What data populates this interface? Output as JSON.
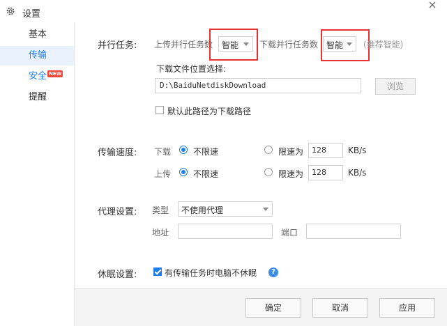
{
  "window": {
    "title": "设置"
  },
  "sidebar": {
    "items": [
      {
        "label": "基本"
      },
      {
        "label": "传输"
      },
      {
        "label": "安全",
        "badge": "NEW"
      },
      {
        "label": "提醒"
      }
    ]
  },
  "parallel": {
    "section_label": "并行任务:",
    "upload_label": "上传并行任务数",
    "upload_value": "智能",
    "download_label": "下载并行任务数",
    "download_value": "智能",
    "hint": "(推荐智能)"
  },
  "download_location": {
    "label": "下载文件位置选择:",
    "path": "D:\\BaiduNetdiskDownload",
    "browse_label": "浏览",
    "default_checkbox_label": "默认此路径为下载路径",
    "default_checked": false
  },
  "speed": {
    "section_label": "传输速度:",
    "download_label": "下载",
    "upload_label": "上传",
    "unlimited_label": "不限速",
    "limit_label": "限速为",
    "download_limit_value": "128",
    "upload_limit_value": "128",
    "unit": "KB/s",
    "download_mode": "unlimited",
    "upload_mode": "unlimited"
  },
  "proxy": {
    "section_label": "代理设置:",
    "type_label": "类型",
    "type_value": "不使用代理",
    "address_label": "地址",
    "port_label": "端口",
    "address_value": "",
    "port_value": ""
  },
  "sleep": {
    "section_label": "休眠设置:",
    "checkbox_label": "有传输任务时电脑不休眠",
    "checked": true,
    "help_glyph": "?"
  },
  "footer": {
    "ok_label": "确定",
    "cancel_label": "取消",
    "apply_label": "应用"
  },
  "colors": {
    "accent": "#1e7ee8",
    "highlight_box": "#e83030",
    "badge": "#f0473a"
  },
  "icons": {
    "title": "gear-icon",
    "close": "close-icon",
    "help": "help-icon"
  }
}
